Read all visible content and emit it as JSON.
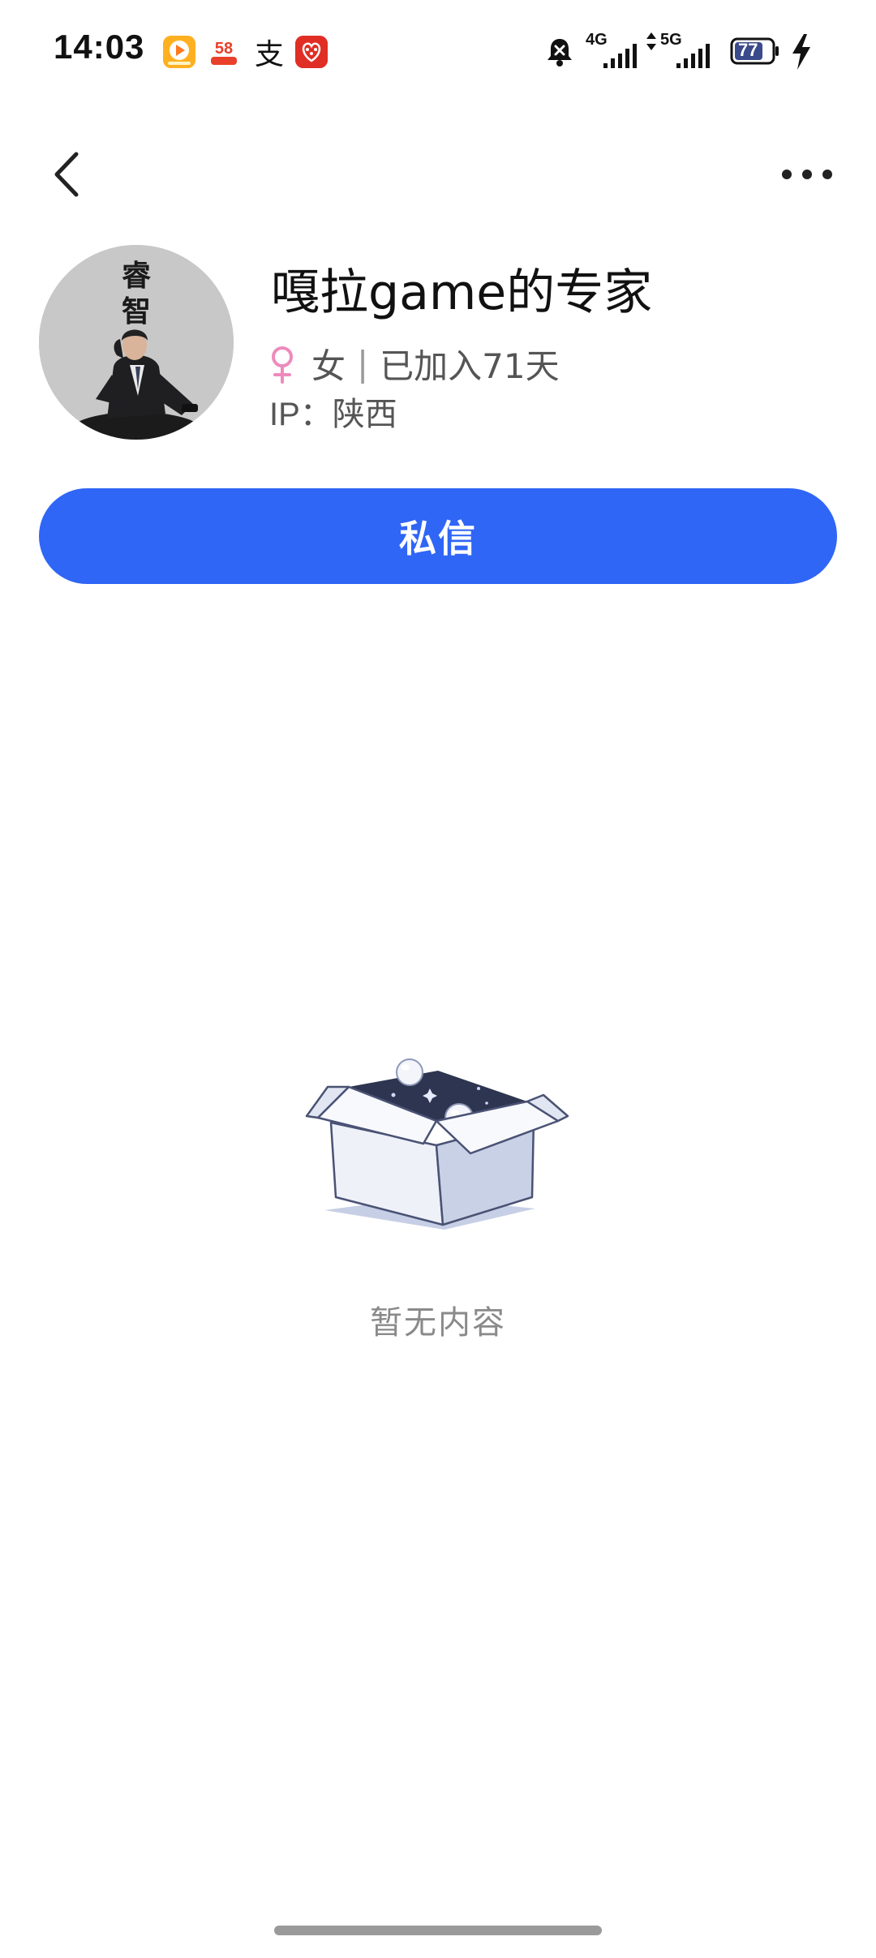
{
  "status_bar": {
    "time": "14:03",
    "app_icons": [
      "video-app-icon",
      "58-app-icon",
      "alipay-icon",
      "pinduoduo-icon"
    ],
    "icon_58_label": "58",
    "alipay_glyph": "支",
    "network_1": "4G",
    "network_2": "5G",
    "battery_level": "77",
    "charging": true
  },
  "nav": {
    "back_icon": "chevron-left-icon",
    "more_icon": "more-horizontal-icon"
  },
  "profile": {
    "avatar_text": "睿智",
    "nickname": "嘎拉game的专家",
    "gender_icon": "female-icon",
    "gender": "女",
    "separator": "|",
    "joined": "已加入71天",
    "ip_label": "IP：",
    "ip_location": "陕西"
  },
  "actions": {
    "message_label": "私信"
  },
  "empty_state": {
    "illustration": "empty-box-illustration",
    "text": "暂无内容"
  },
  "colors": {
    "primary": "#2f66f6",
    "female": "#ee8bbd",
    "muted_text": "#8a8a8a"
  }
}
